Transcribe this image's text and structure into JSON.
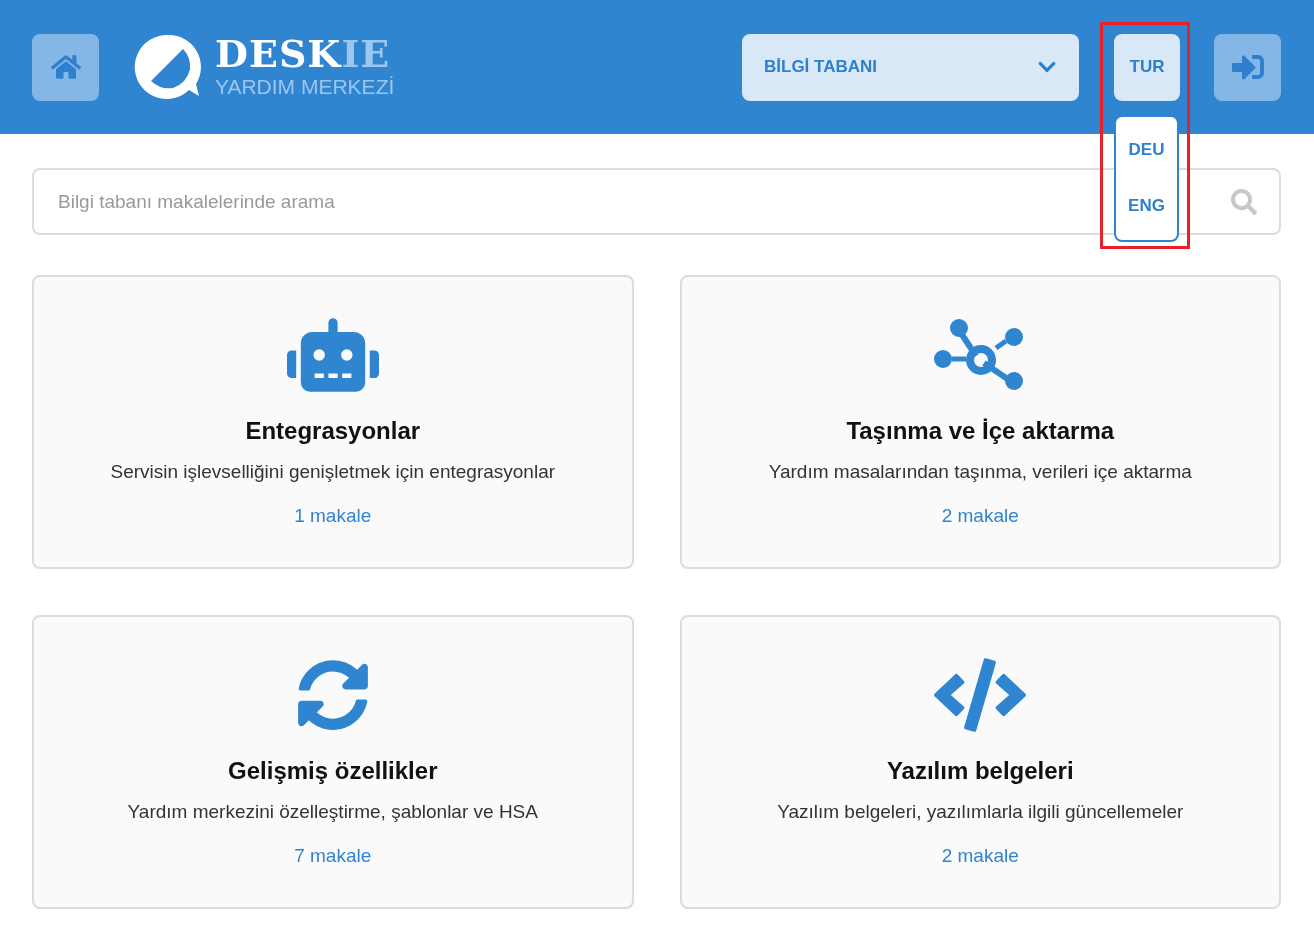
{
  "header": {
    "brand": {
      "main": "DESK",
      "accent": "IE",
      "subtitle": "YARDIM MERKEZİ"
    },
    "section_dropdown": {
      "value": "BİLGİ TABANI"
    },
    "language": {
      "current": "TUR",
      "expanded": true,
      "options": [
        {
          "label": "DEU"
        },
        {
          "label": "ENG"
        }
      ]
    }
  },
  "search": {
    "placeholder": "Bilgi tabanı makalelerinde arama"
  },
  "categories": [
    {
      "kind": "robot",
      "title": "Entegrasyonlar",
      "description": "Servisin işlevselliğini genişletmek için entegrasyonlar",
      "count": "1 makale"
    },
    {
      "kind": "network",
      "title": "Taşınma ve İçe aktarma",
      "description": "Yardım masalarından taşınma, verileri içe aktarma",
      "count": "2 makale"
    },
    {
      "kind": "sync",
      "title": "Gelişmiş özellikler",
      "description": "Yardım merkezini özelleştirme, şablonlar ve HSA",
      "count": "7 makale"
    },
    {
      "kind": "code",
      "title": "Yazılım belgeleri",
      "description": "Yazılım belgeleri, yazılımlarla ilgili güncellemeler",
      "count": "2 makale"
    }
  ]
}
